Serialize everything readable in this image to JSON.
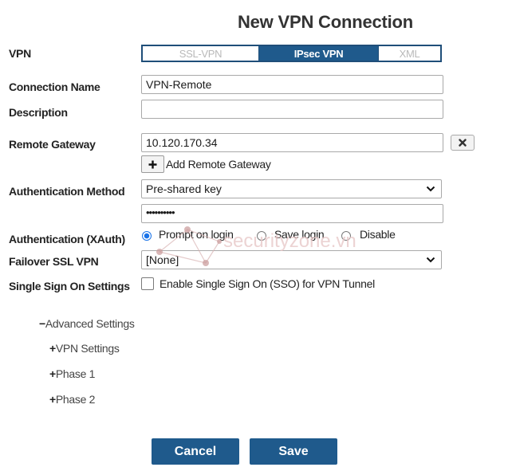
{
  "title": "New VPN Connection",
  "vpn": {
    "label": "VPN",
    "options": [
      "SSL-VPN",
      "IPsec VPN",
      "XML"
    ],
    "selected": "IPsec VPN"
  },
  "connection_name": {
    "label": "Connection Name",
    "value": "VPN-Remote"
  },
  "description": {
    "label": "Description",
    "value": ""
  },
  "remote_gateway": {
    "label": "Remote Gateway",
    "value": "10.120.170.34",
    "add_label": "Add Remote Gateway"
  },
  "auth_method": {
    "label": "Authentication Method",
    "selected": "Pre-shared key",
    "key_mask": "••••••••••"
  },
  "xauth": {
    "label": "Authentication (XAuth)",
    "options": [
      "Prompt on login",
      "Save login",
      "Disable"
    ],
    "selected": "Prompt on login"
  },
  "failover": {
    "label": "Failover SSL VPN",
    "selected": "[None]"
  },
  "sso": {
    "label": "Single Sign On Settings",
    "checkbox_label": "Enable Single Sign On (SSO) for VPN Tunnel",
    "checked": false
  },
  "advanced": {
    "label": "Advanced Settings",
    "expand_symbol": "−",
    "items": [
      {
        "label": "VPN Settings",
        "symbol": "+"
      },
      {
        "label": "Phase 1",
        "symbol": "+"
      },
      {
        "label": "Phase 2",
        "symbol": "+"
      }
    ]
  },
  "buttons": {
    "cancel": "Cancel",
    "save": "Save"
  },
  "watermark_text": "securityzone.vn",
  "colors": {
    "accent": "#1f5a8c",
    "radio": "#1a73e8"
  }
}
